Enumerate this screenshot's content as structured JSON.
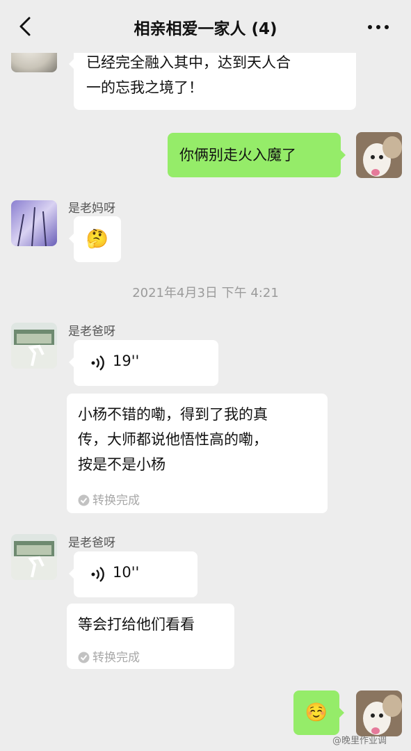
{
  "header": {
    "title": "相亲相爱一家人 (4)",
    "back_icon": "chevron-left-icon",
    "more_icon": "more-dots-icon"
  },
  "messages": {
    "m1_text": "已经完全融入其中，达到天人合一的忘我之境了！",
    "m1_line1": "已经完全融入其中，达到天人合",
    "m1_line2": "一的忘我之境了！",
    "m2_text": "你俩别走火入魔了",
    "m3_sender": "是老妈呀",
    "m3_emoji": "🤔",
    "m4_sender": "是老爸呀",
    "m4_voice_duration": "19''",
    "m4_transcript_line1": "小杨不错的嘞，得到了我的真",
    "m4_transcript_line2": "传，大师都说他悟性高的嘞，",
    "m4_transcript_line3": "按是不是小杨",
    "m4_transcript_status": "转换完成",
    "m5_sender": "是老爸呀",
    "m5_voice_duration": "10''",
    "m5_transcript": "等会打给他们看看",
    "m5_transcript_status": "转换完成",
    "m6_emoji": "☺️"
  },
  "timestamp": "2021年4月3日 下午 4:21",
  "watermark": "@晚里作业调",
  "colors": {
    "background": "#ededed",
    "bubble_self": "#95ec69",
    "bubble_other": "#ffffff"
  }
}
